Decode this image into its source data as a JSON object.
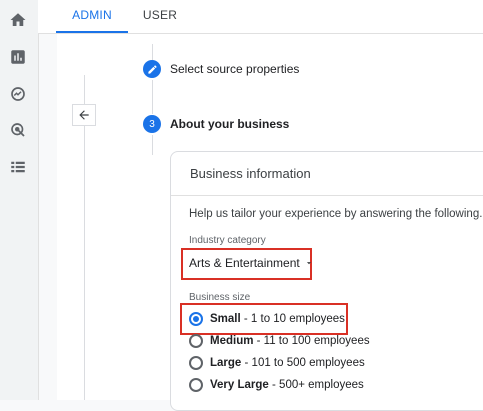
{
  "rail": {
    "icons": [
      "home-icon",
      "reports-icon",
      "explore-icon",
      "advertising-icon",
      "configure-icon"
    ]
  },
  "tabs": [
    {
      "label": "ADMIN",
      "active": true
    },
    {
      "label": "USER",
      "active": false
    }
  ],
  "back": {
    "icon": "arrow-left-icon"
  },
  "steps": [
    {
      "icon": "pencil-icon",
      "label": "Select source properties"
    },
    {
      "number": "3",
      "label": "About your business"
    }
  ],
  "card": {
    "title": "Business information",
    "help_text": "Help us tailor your experience by answering the following.",
    "industry": {
      "label": "Industry category",
      "value": "Arts & Entertainment"
    },
    "size": {
      "label": "Business size",
      "options": [
        {
          "name": "Small",
          "detail": " - 1 to 10 employees",
          "checked": true
        },
        {
          "name": "Medium",
          "detail": " - 11 to 100 employees",
          "checked": false
        },
        {
          "name": "Large",
          "detail": " - 101 to 500 employees",
          "checked": false
        },
        {
          "name": "Very Large",
          "detail": " - 500+ employees",
          "checked": false
        }
      ]
    }
  },
  "colors": {
    "accent": "#1a73e8",
    "highlight": "#d93025"
  }
}
